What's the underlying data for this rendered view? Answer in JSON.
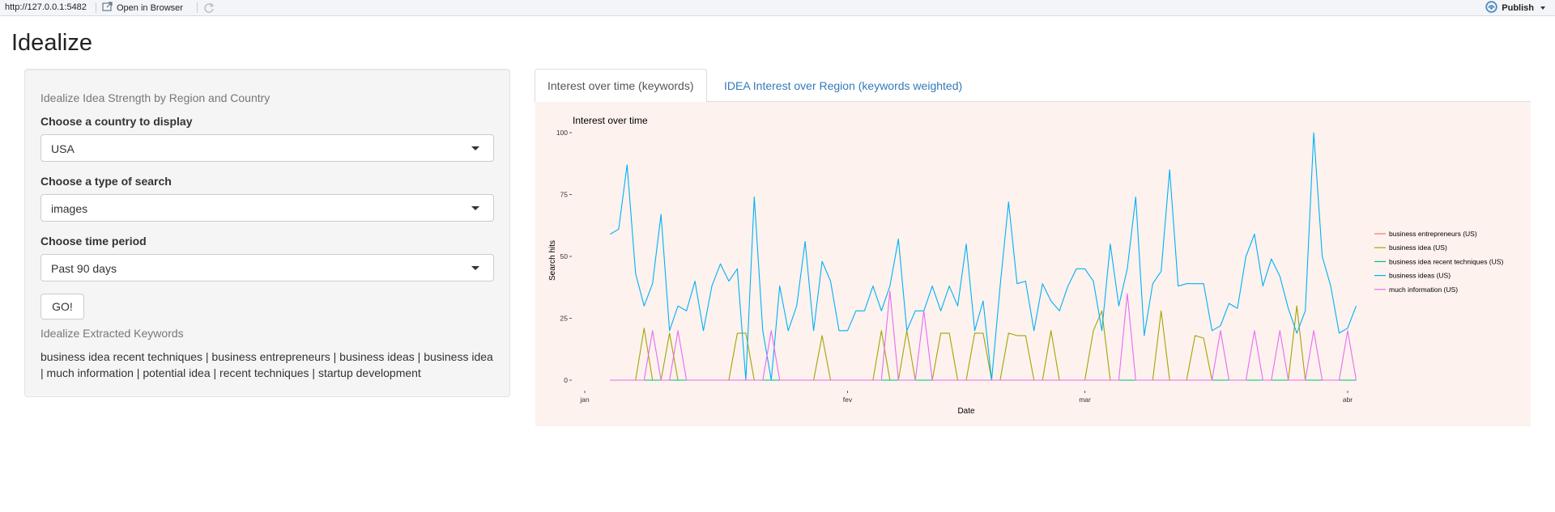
{
  "viewer": {
    "url": "http://127.0.0.1:5482",
    "open_in_browser": "Open in Browser",
    "publish": "Publish"
  },
  "app": {
    "title": "Idealize"
  },
  "sidebar": {
    "heading": "Idealize Idea Strength by Region and Country",
    "country": {
      "label": "Choose a country to display",
      "value": "USA"
    },
    "search_type": {
      "label": "Choose a type of search",
      "value": "images"
    },
    "time_period": {
      "label": "Choose time period",
      "value": "Past 90 days"
    },
    "go_label": "GO!",
    "keywords_heading": "Idealize Extracted Keywords",
    "keywords_text": "business idea recent techniques | business entrepreneurs | business ideas | business idea | much information | potential idea | recent techniques | startup development"
  },
  "tabs": [
    {
      "label": "Interest over time (keywords)",
      "active": true
    },
    {
      "label": "IDEA Interest over Region (keywords weighted)",
      "active": false
    }
  ],
  "colors": {
    "accent_link": "#337ab7",
    "plot_background": "#fdf2ee",
    "publish_icon": "#4b8bbe"
  },
  "chart_data": {
    "type": "line",
    "title": "Interest over time",
    "xlabel": "Date",
    "ylabel": "Search hits",
    "ylim": [
      0,
      100
    ],
    "y_ticks": [
      0,
      25,
      50,
      75,
      100
    ],
    "x_ticks": [
      {
        "label": "jan",
        "date": "2019-01-01"
      },
      {
        "label": "fev",
        "date": "2019-02-01"
      },
      {
        "label": "mar",
        "date": "2019-03-01"
      },
      {
        "label": "abr",
        "date": "2019-04-01"
      }
    ],
    "xlim": [
      "2019-01-01",
      "2019-04-01"
    ],
    "x": [
      "2019-01-04",
      "2019-01-05",
      "2019-01-06",
      "2019-01-07",
      "2019-01-08",
      "2019-01-09",
      "2019-01-10",
      "2019-01-11",
      "2019-01-12",
      "2019-01-13",
      "2019-01-14",
      "2019-01-15",
      "2019-01-16",
      "2019-01-17",
      "2019-01-18",
      "2019-01-19",
      "2019-01-20",
      "2019-01-21",
      "2019-01-22",
      "2019-01-23",
      "2019-01-24",
      "2019-01-25",
      "2019-01-26",
      "2019-01-27",
      "2019-01-28",
      "2019-01-29",
      "2019-01-30",
      "2019-01-31",
      "2019-02-01",
      "2019-02-02",
      "2019-02-03",
      "2019-02-04",
      "2019-02-05",
      "2019-02-06",
      "2019-02-07",
      "2019-02-08",
      "2019-02-09",
      "2019-02-10",
      "2019-02-11",
      "2019-02-12",
      "2019-02-13",
      "2019-02-14",
      "2019-02-15",
      "2019-02-16",
      "2019-02-17",
      "2019-02-18",
      "2019-02-19",
      "2019-02-20",
      "2019-02-21",
      "2019-02-22",
      "2019-02-23",
      "2019-02-24",
      "2019-02-25",
      "2019-02-26",
      "2019-02-27",
      "2019-02-28",
      "2019-03-01",
      "2019-03-02",
      "2019-03-03",
      "2019-03-04",
      "2019-03-05",
      "2019-03-06",
      "2019-03-07",
      "2019-03-08",
      "2019-03-09",
      "2019-03-10",
      "2019-03-11",
      "2019-03-12",
      "2019-03-13",
      "2019-03-14",
      "2019-03-15",
      "2019-03-16",
      "2019-03-17",
      "2019-03-18",
      "2019-03-19",
      "2019-03-20",
      "2019-03-21",
      "2019-03-22",
      "2019-03-23",
      "2019-03-24",
      "2019-03-25",
      "2019-03-26",
      "2019-03-27",
      "2019-03-28",
      "2019-03-29",
      "2019-03-30",
      "2019-03-31",
      "2019-04-01",
      "2019-04-02"
    ],
    "legend_position": "right",
    "series": [
      {
        "name": "business entrepreneurs (US)",
        "color": "#F8766D",
        "values": [
          0,
          0,
          0,
          0,
          0,
          0,
          0,
          0,
          0,
          0,
          0,
          0,
          0,
          0,
          0,
          0,
          0,
          0,
          0,
          0,
          0,
          0,
          0,
          0,
          0,
          0,
          0,
          0,
          0,
          0,
          0,
          0,
          0,
          0,
          0,
          0,
          0,
          0,
          0,
          0,
          0,
          0,
          0,
          0,
          0,
          0,
          0,
          0,
          0,
          0,
          0,
          0,
          0,
          0,
          0,
          0,
          0,
          0,
          0,
          0,
          0,
          0,
          0,
          0,
          0,
          0,
          0,
          0,
          0,
          0,
          0,
          0,
          0,
          0,
          0,
          0,
          0,
          0,
          0,
          0,
          0,
          0,
          0,
          0,
          0,
          0,
          0,
          0,
          0
        ]
      },
      {
        "name": "business idea (US)",
        "color": "#A3A500",
        "values": [
          0,
          0,
          0,
          0,
          21,
          0,
          0,
          19,
          0,
          0,
          0,
          0,
          0,
          0,
          0,
          19,
          19,
          0,
          0,
          0,
          0,
          0,
          0,
          0,
          0,
          18,
          0,
          0,
          0,
          0,
          0,
          0,
          20,
          0,
          0,
          20,
          0,
          0,
          0,
          19,
          19,
          0,
          0,
          19,
          19,
          0,
          0,
          19,
          18,
          18,
          0,
          0,
          20,
          0,
          0,
          0,
          0,
          20,
          28,
          0,
          0,
          0,
          0,
          0,
          0,
          28,
          0,
          0,
          0,
          18,
          17,
          0,
          0,
          0,
          0,
          0,
          0,
          0,
          0,
          0,
          0,
          30,
          0,
          0,
          0,
          0,
          0,
          0,
          0
        ]
      },
      {
        "name": "business idea recent techniques (US)",
        "color": "#00BF7D",
        "values": [
          0,
          0,
          0,
          0,
          0,
          0,
          0,
          0,
          0,
          0,
          0,
          0,
          0,
          0,
          0,
          0,
          0,
          0,
          0,
          0,
          0,
          0,
          0,
          0,
          0,
          0,
          0,
          0,
          0,
          0,
          0,
          0,
          0,
          0,
          0,
          0,
          0,
          0,
          0,
          0,
          0,
          0,
          0,
          0,
          0,
          0,
          0,
          0,
          0,
          0,
          0,
          0,
          0,
          0,
          0,
          0,
          0,
          0,
          0,
          0,
          0,
          0,
          0,
          0,
          0,
          0,
          0,
          0,
          0,
          0,
          0,
          0,
          0,
          0,
          0,
          0,
          0,
          0,
          0,
          0,
          0,
          0,
          0,
          0,
          0,
          0,
          0,
          0,
          0
        ]
      },
      {
        "name": "business ideas (US)",
        "color": "#00B0F6",
        "values": [
          59,
          61,
          87,
          43,
          30,
          39,
          67,
          20,
          30,
          28,
          40,
          20,
          38,
          47,
          40,
          45,
          0,
          74,
          20,
          0,
          38,
          20,
          30,
          56,
          20,
          48,
          40,
          20,
          20,
          28,
          28,
          38,
          28,
          38,
          57,
          20,
          28,
          28,
          38,
          28,
          38,
          30,
          55,
          20,
          32,
          0,
          38,
          72,
          39,
          40,
          20,
          39,
          32,
          28,
          38,
          45,
          45,
          40,
          20,
          55,
          30,
          45,
          74,
          18,
          39,
          44,
          85,
          38,
          39,
          39,
          39,
          20,
          22,
          31,
          29,
          50,
          59,
          38,
          49,
          42,
          29,
          19,
          28,
          100,
          50,
          38,
          19,
          21,
          30
        ]
      },
      {
        "name": "much information (US)",
        "color": "#E76BF3",
        "values": [
          0,
          0,
          0,
          0,
          0,
          20,
          0,
          0,
          20,
          0,
          0,
          0,
          0,
          0,
          0,
          0,
          0,
          0,
          0,
          20,
          0,
          0,
          0,
          0,
          0,
          0,
          0,
          0,
          0,
          0,
          0,
          0,
          0,
          36,
          0,
          0,
          0,
          28,
          0,
          0,
          0,
          0,
          0,
          0,
          0,
          0,
          0,
          0,
          0,
          0,
          0,
          0,
          0,
          0,
          0,
          0,
          0,
          0,
          0,
          0,
          0,
          35,
          0,
          0,
          0,
          0,
          0,
          0,
          0,
          0,
          0,
          0,
          20,
          0,
          0,
          0,
          20,
          0,
          0,
          20,
          0,
          0,
          0,
          20,
          0,
          0,
          0,
          20,
          0
        ]
      }
    ]
  }
}
